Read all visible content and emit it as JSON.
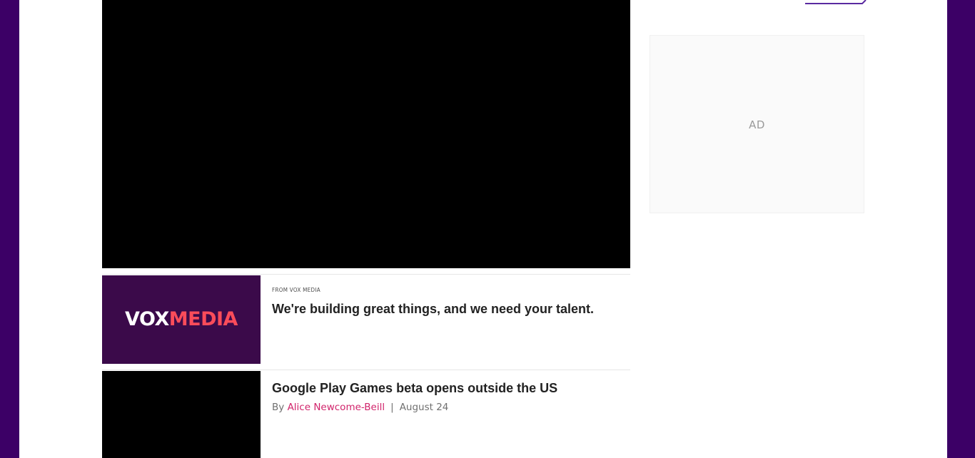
{
  "colors": {
    "brand_frame": "#3c0066",
    "author_link": "#d1246b",
    "vox_logo_bg": "#3b0a4a",
    "vox_logo_accent": "#fa4c5a",
    "sidebar_button_line": "#5a2aa0"
  },
  "video": {
    "state": "black frame"
  },
  "stories": [
    {
      "eyebrow": "FROM VOX MEDIA",
      "headline": "We're building great things, and we need your talent.",
      "logo": {
        "part1": "VOX",
        "part2": "MEDIA"
      }
    },
    {
      "headline": "Google Play Games beta opens outside the US",
      "byline_prefix": "By",
      "author": "Alice Newcome-Beill",
      "separator": "|",
      "date": "August 24"
    }
  ],
  "sidebar": {
    "ad_label": "AD"
  }
}
